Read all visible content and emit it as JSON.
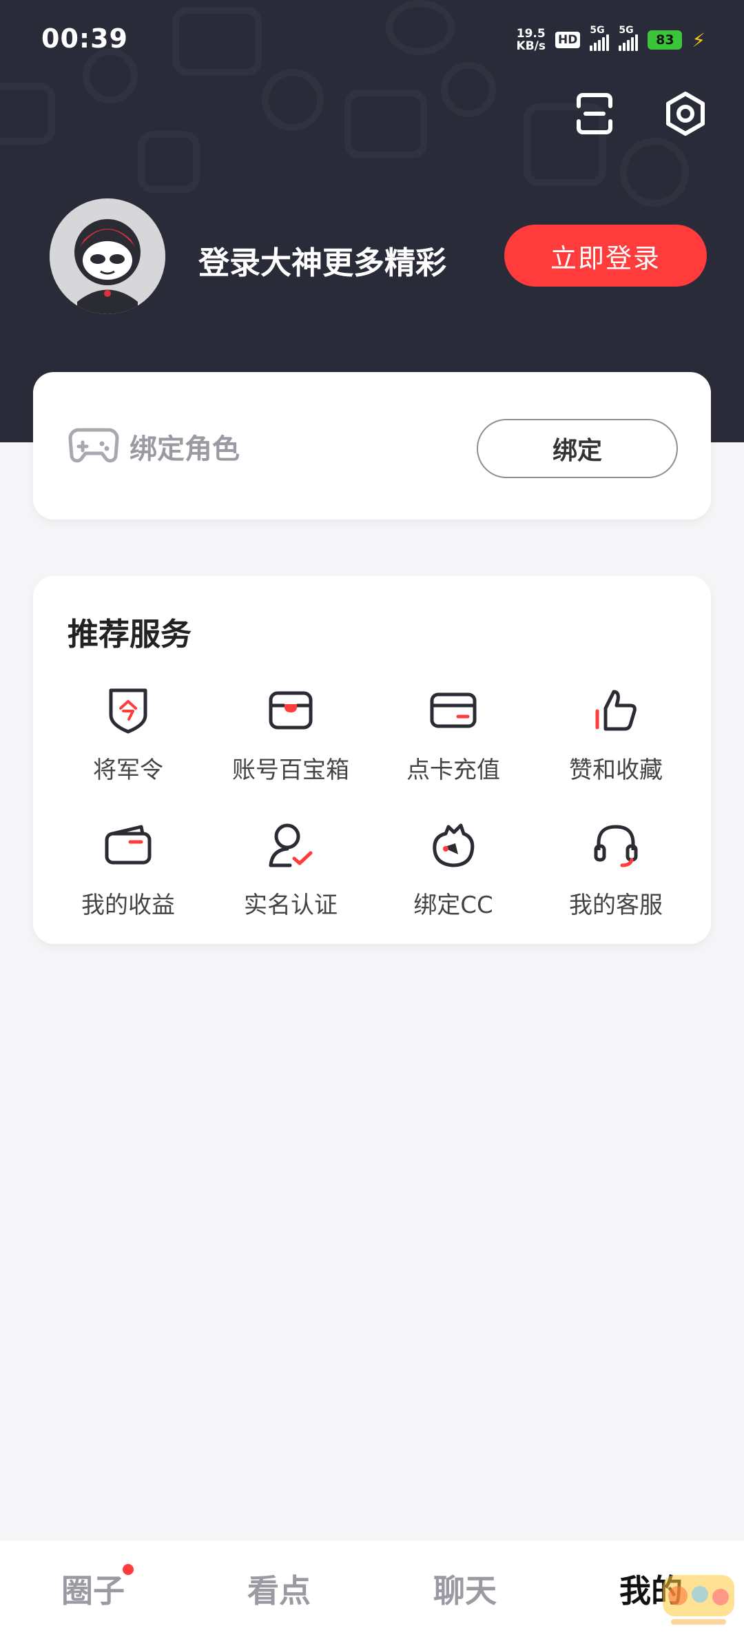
{
  "status_bar": {
    "time": "00:39",
    "net_speed_value": "19.5",
    "net_speed_unit": "KB/s",
    "hd_label": "HD",
    "sim1_label": "5G",
    "sim2_label": "5G",
    "battery": "83"
  },
  "header": {
    "login_prompt": "登录大神更多精彩",
    "login_button": "立即登录"
  },
  "bind_card": {
    "label": "绑定角色",
    "button": "绑定"
  },
  "services": {
    "title": "推荐服务",
    "items": [
      {
        "label": "将军令",
        "icon": "shield-token-icon"
      },
      {
        "label": "账号百宝箱",
        "icon": "treasure-box-icon"
      },
      {
        "label": "点卡充值",
        "icon": "card-icon"
      },
      {
        "label": "赞和收藏",
        "icon": "thumbs-up-icon"
      },
      {
        "label": "我的收益",
        "icon": "wallet-icon"
      },
      {
        "label": "实名认证",
        "icon": "verified-user-icon"
      },
      {
        "label": "绑定CC",
        "icon": "cc-mascot-icon"
      },
      {
        "label": "我的客服",
        "icon": "headset-icon"
      }
    ]
  },
  "tabbar": {
    "tabs": [
      "圈子",
      "看点",
      "聊天",
      "我的"
    ],
    "active_index": 3
  },
  "colors": {
    "header_bg": "#2a2b38",
    "accent": "#ff3b3b",
    "page_bg": "#f6f6f9"
  }
}
